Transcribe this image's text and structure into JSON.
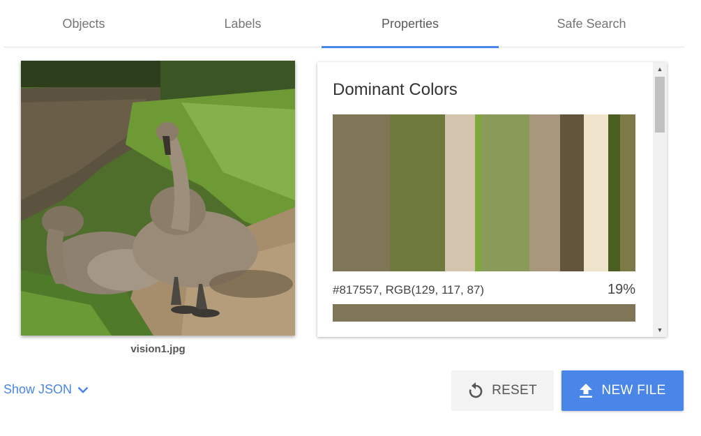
{
  "tabs": [
    {
      "label": "Objects"
    },
    {
      "label": "Labels"
    },
    {
      "label": "Properties"
    },
    {
      "label": "Safe Search"
    }
  ],
  "active_tab": "Properties",
  "image": {
    "filename": "vision1.jpg"
  },
  "properties": {
    "title": "Dominant Colors",
    "swatches": [
      {
        "color": "#817557",
        "weight": 19
      },
      {
        "color": "#6e7a3c",
        "weight": 18
      },
      {
        "color": "#d3c5ad",
        "weight": 10
      },
      {
        "color": "#7ea83e",
        "weight": 2
      },
      {
        "color": "#8a9a58",
        "weight": 16
      },
      {
        "color": "#a8977d",
        "weight": 10
      },
      {
        "color": "#63553c",
        "weight": 8
      },
      {
        "color": "#efe3cb",
        "weight": 8
      },
      {
        "color": "#4a5e22",
        "weight": 4
      },
      {
        "color": "#7d7a48",
        "weight": 5
      }
    ],
    "selected": {
      "code": "#817557,  RGB(129, 117, 87)",
      "percent": "19%",
      "color": "#817557"
    }
  },
  "controls": {
    "show_json": "Show JSON",
    "reset": "RESET",
    "new_file": "NEW FILE"
  },
  "colors": {
    "accent": "#4a86e8"
  }
}
